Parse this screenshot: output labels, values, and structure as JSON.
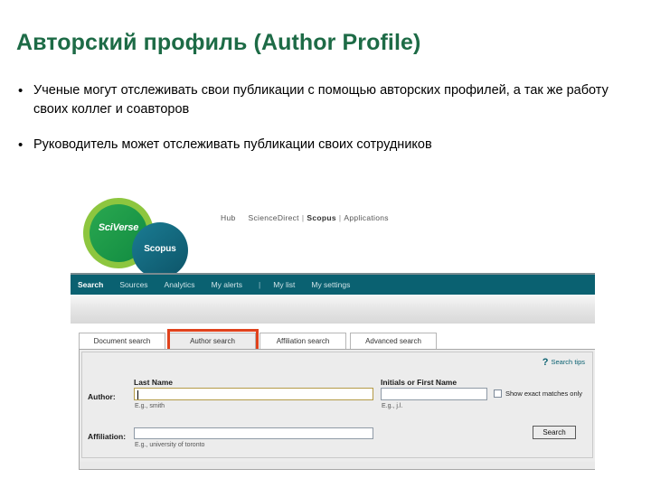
{
  "slide": {
    "title": "Авторский профиль (Author Profile)",
    "bullet_marker": "•",
    "bullets": [
      "Ученые могут отслеживать свои публикации с помощью авторских профилей, а так же работу своих коллег и соавторов",
      "Руководитель может отслеживать публикации своих сотрудников"
    ],
    "title_color": "#1d6b46"
  },
  "screenshot": {
    "brand": {
      "sciverse_label": "SciVerse",
      "scopus_label": "Scopus",
      "ring_color": "#8dc63f",
      "circle_color": "#1a9e4b",
      "blob_color": "#12647a"
    },
    "toplinks": {
      "hub": "Hub",
      "sciencedirect": "ScienceDirect",
      "scopus": "Scopus",
      "applications": "Applications",
      "separator": "|"
    },
    "nav": {
      "bar_color": "#0a6171",
      "items": [
        {
          "label": "Search",
          "active": true
        },
        {
          "label": "Sources",
          "active": false
        },
        {
          "label": "Analytics",
          "active": false
        },
        {
          "label": "My alerts",
          "active": false
        },
        {
          "label": "My list",
          "active": false
        },
        {
          "label": "My settings",
          "active": false
        }
      ],
      "separator": "|"
    },
    "tabs": [
      {
        "label": "Document search",
        "selected": false
      },
      {
        "label": "Author search",
        "selected": true
      },
      {
        "label": "Affiliation search",
        "selected": false
      },
      {
        "label": "Advanced search",
        "selected": false
      }
    ],
    "highlight_color": "#e0421c",
    "form": {
      "search_tips": "Search tips",
      "search_tips_icon": "question-mark-icon",
      "author_row_label": "Author:",
      "affiliation_row_label": "Affiliation:",
      "last_name_label": "Last Name",
      "last_name_value": "",
      "last_name_hint": "E.g., smith",
      "initials_label": "Initials or First Name",
      "initials_value": "",
      "initials_hint": "E.g., j.l.",
      "affiliation_value": "",
      "affiliation_hint": "E.g., university of toronto",
      "exact_matches_label": "Show exact matches only",
      "exact_matches_checked": false,
      "search_button": "Search"
    }
  }
}
